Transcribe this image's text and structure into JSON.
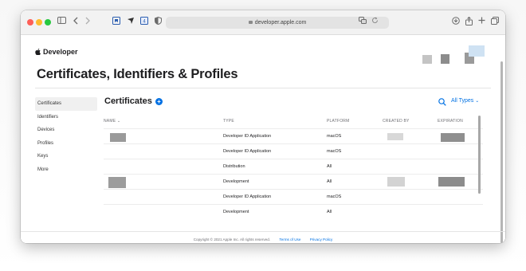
{
  "browser": {
    "url": "developer.apple.com",
    "icons": [
      "sidebar-icon",
      "back-icon",
      "forward-icon",
      "bookmark-icon",
      "extension-icon",
      "reader-icon",
      "privacy-icon",
      "translate-icon",
      "reload-icon",
      "download-icon",
      "share-icon",
      "new-tab-icon",
      "tabs-icon"
    ]
  },
  "header": {
    "brand": "Developer"
  },
  "page": {
    "title": "Certificates, Identifiers & Profiles"
  },
  "sidebar": {
    "items": [
      {
        "label": "Certificates",
        "active": true
      },
      {
        "label": "Identifiers",
        "active": false
      },
      {
        "label": "Devices",
        "active": false
      },
      {
        "label": "Profiles",
        "active": false
      },
      {
        "label": "Keys",
        "active": false
      },
      {
        "label": "More",
        "active": false
      }
    ]
  },
  "section": {
    "title": "Certificates",
    "filter_label": "All Types"
  },
  "table": {
    "columns": [
      "NAME",
      "TYPE",
      "PLATFORM",
      "CREATED BY",
      "EXPIRATION"
    ],
    "rows": [
      {
        "type": "Developer ID Application",
        "platform": "macOS"
      },
      {
        "type": "Developer ID Application",
        "platform": "macOS"
      },
      {
        "type": "Distribution",
        "platform": "All"
      },
      {
        "type": "Development",
        "platform": "All"
      },
      {
        "type": "Developer ID Application",
        "platform": "macOS"
      },
      {
        "type": "Development",
        "platform": "All"
      }
    ]
  },
  "footer": {
    "copyright": "Copyright © 2021 Apple Inc. All rights reserved.",
    "terms": "Terms of Use",
    "privacy": "Privacy Policy"
  },
  "colors": {
    "accent": "#0071e3",
    "traffic_red": "#fe5f57",
    "traffic_yellow": "#febc2e",
    "traffic_green": "#28c840"
  }
}
